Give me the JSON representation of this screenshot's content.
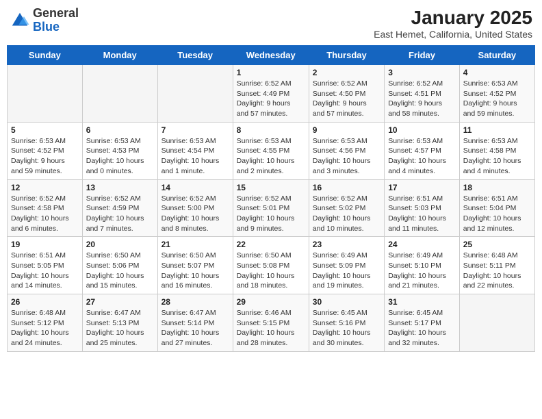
{
  "header": {
    "logo_general": "General",
    "logo_blue": "Blue",
    "title": "January 2025",
    "subtitle": "East Hemet, California, United States"
  },
  "days_of_week": [
    "Sunday",
    "Monday",
    "Tuesday",
    "Wednesday",
    "Thursday",
    "Friday",
    "Saturday"
  ],
  "weeks": [
    [
      {
        "day": "",
        "info": ""
      },
      {
        "day": "",
        "info": ""
      },
      {
        "day": "",
        "info": ""
      },
      {
        "day": "1",
        "info": "Sunrise: 6:52 AM\nSunset: 4:49 PM\nDaylight: 9 hours\nand 57 minutes."
      },
      {
        "day": "2",
        "info": "Sunrise: 6:52 AM\nSunset: 4:50 PM\nDaylight: 9 hours\nand 57 minutes."
      },
      {
        "day": "3",
        "info": "Sunrise: 6:52 AM\nSunset: 4:51 PM\nDaylight: 9 hours\nand 58 minutes."
      },
      {
        "day": "4",
        "info": "Sunrise: 6:53 AM\nSunset: 4:52 PM\nDaylight: 9 hours\nand 59 minutes."
      }
    ],
    [
      {
        "day": "5",
        "info": "Sunrise: 6:53 AM\nSunset: 4:52 PM\nDaylight: 9 hours\nand 59 minutes."
      },
      {
        "day": "6",
        "info": "Sunrise: 6:53 AM\nSunset: 4:53 PM\nDaylight: 10 hours\nand 0 minutes."
      },
      {
        "day": "7",
        "info": "Sunrise: 6:53 AM\nSunset: 4:54 PM\nDaylight: 10 hours\nand 1 minute."
      },
      {
        "day": "8",
        "info": "Sunrise: 6:53 AM\nSunset: 4:55 PM\nDaylight: 10 hours\nand 2 minutes."
      },
      {
        "day": "9",
        "info": "Sunrise: 6:53 AM\nSunset: 4:56 PM\nDaylight: 10 hours\nand 3 minutes."
      },
      {
        "day": "10",
        "info": "Sunrise: 6:53 AM\nSunset: 4:57 PM\nDaylight: 10 hours\nand 4 minutes."
      },
      {
        "day": "11",
        "info": "Sunrise: 6:53 AM\nSunset: 4:58 PM\nDaylight: 10 hours\nand 4 minutes."
      }
    ],
    [
      {
        "day": "12",
        "info": "Sunrise: 6:52 AM\nSunset: 4:58 PM\nDaylight: 10 hours\nand 6 minutes."
      },
      {
        "day": "13",
        "info": "Sunrise: 6:52 AM\nSunset: 4:59 PM\nDaylight: 10 hours\nand 7 minutes."
      },
      {
        "day": "14",
        "info": "Sunrise: 6:52 AM\nSunset: 5:00 PM\nDaylight: 10 hours\nand 8 minutes."
      },
      {
        "day": "15",
        "info": "Sunrise: 6:52 AM\nSunset: 5:01 PM\nDaylight: 10 hours\nand 9 minutes."
      },
      {
        "day": "16",
        "info": "Sunrise: 6:52 AM\nSunset: 5:02 PM\nDaylight: 10 hours\nand 10 minutes."
      },
      {
        "day": "17",
        "info": "Sunrise: 6:51 AM\nSunset: 5:03 PM\nDaylight: 10 hours\nand 11 minutes."
      },
      {
        "day": "18",
        "info": "Sunrise: 6:51 AM\nSunset: 5:04 PM\nDaylight: 10 hours\nand 12 minutes."
      }
    ],
    [
      {
        "day": "19",
        "info": "Sunrise: 6:51 AM\nSunset: 5:05 PM\nDaylight: 10 hours\nand 14 minutes."
      },
      {
        "day": "20",
        "info": "Sunrise: 6:50 AM\nSunset: 5:06 PM\nDaylight: 10 hours\nand 15 minutes."
      },
      {
        "day": "21",
        "info": "Sunrise: 6:50 AM\nSunset: 5:07 PM\nDaylight: 10 hours\nand 16 minutes."
      },
      {
        "day": "22",
        "info": "Sunrise: 6:50 AM\nSunset: 5:08 PM\nDaylight: 10 hours\nand 18 minutes."
      },
      {
        "day": "23",
        "info": "Sunrise: 6:49 AM\nSunset: 5:09 PM\nDaylight: 10 hours\nand 19 minutes."
      },
      {
        "day": "24",
        "info": "Sunrise: 6:49 AM\nSunset: 5:10 PM\nDaylight: 10 hours\nand 21 minutes."
      },
      {
        "day": "25",
        "info": "Sunrise: 6:48 AM\nSunset: 5:11 PM\nDaylight: 10 hours\nand 22 minutes."
      }
    ],
    [
      {
        "day": "26",
        "info": "Sunrise: 6:48 AM\nSunset: 5:12 PM\nDaylight: 10 hours\nand 24 minutes."
      },
      {
        "day": "27",
        "info": "Sunrise: 6:47 AM\nSunset: 5:13 PM\nDaylight: 10 hours\nand 25 minutes."
      },
      {
        "day": "28",
        "info": "Sunrise: 6:47 AM\nSunset: 5:14 PM\nDaylight: 10 hours\nand 27 minutes."
      },
      {
        "day": "29",
        "info": "Sunrise: 6:46 AM\nSunset: 5:15 PM\nDaylight: 10 hours\nand 28 minutes."
      },
      {
        "day": "30",
        "info": "Sunrise: 6:45 AM\nSunset: 5:16 PM\nDaylight: 10 hours\nand 30 minutes."
      },
      {
        "day": "31",
        "info": "Sunrise: 6:45 AM\nSunset: 5:17 PM\nDaylight: 10 hours\nand 32 minutes."
      },
      {
        "day": "",
        "info": ""
      }
    ]
  ]
}
